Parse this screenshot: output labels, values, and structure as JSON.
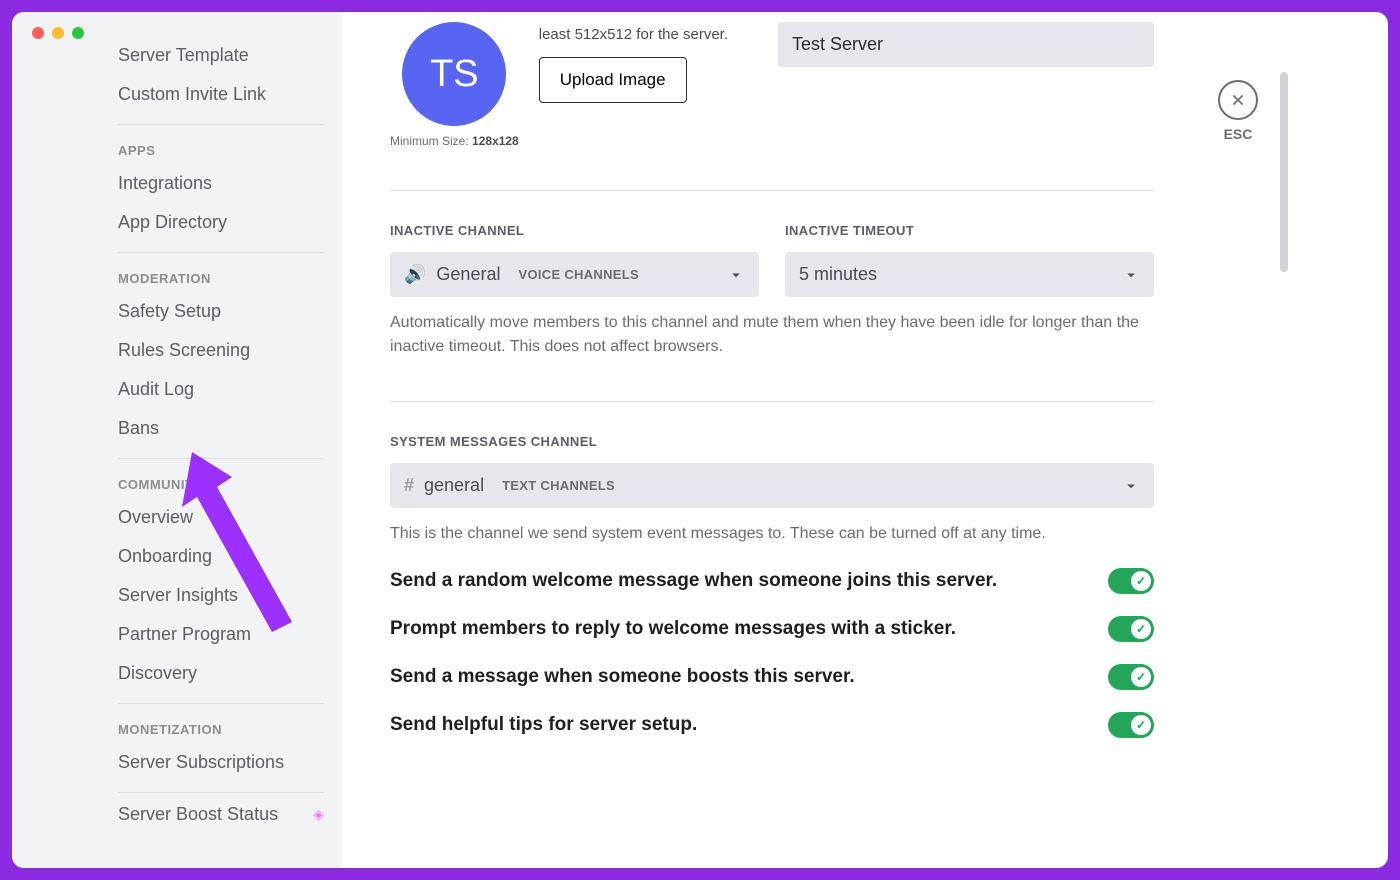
{
  "window": {
    "traffic": [
      "close",
      "min",
      "max"
    ]
  },
  "sidebar": {
    "top_items": [
      "Server Template",
      "Custom Invite Link"
    ],
    "groups": [
      {
        "header": "APPS",
        "items": [
          "Integrations",
          "App Directory"
        ]
      },
      {
        "header": "MODERATION",
        "items": [
          "Safety Setup",
          "Rules Screening",
          "Audit Log",
          "Bans"
        ]
      },
      {
        "header": "COMMUNITY",
        "items": [
          "Overview",
          "Onboarding",
          "Server Insights",
          "Partner Program",
          "Discovery"
        ]
      },
      {
        "header": "MONETIZATION",
        "items": [
          "Server Subscriptions"
        ]
      }
    ],
    "boost_item": "Server Boost Status"
  },
  "close": {
    "esc": "ESC"
  },
  "overview": {
    "avatar_initials": "TS",
    "min_size_prefix": "Minimum Size: ",
    "min_size_value": "128x128",
    "size_note": "least 512x512 for the server.",
    "upload_button": "Upload Image",
    "server_name": "Test Server",
    "inactive_channel_label": "INACTIVE CHANNEL",
    "inactive_channel_value": "General",
    "inactive_channel_sub": "VOICE CHANNELS",
    "inactive_timeout_label": "INACTIVE TIMEOUT",
    "inactive_timeout_value": "5 minutes",
    "inactive_help": "Automatically move members to this channel and mute them when they have been idle for longer than the inactive timeout. This does not affect browsers.",
    "system_label": "SYSTEM MESSAGES CHANNEL",
    "system_value": "general",
    "system_sub": "TEXT CHANNELS",
    "system_help": "This is the channel we send system event messages to. These can be turned off at any time.",
    "toggles": [
      "Send a random welcome message when someone joins this server.",
      "Prompt members to reply to welcome messages with a sticker.",
      "Send a message when someone boosts this server.",
      "Send helpful tips for server setup."
    ]
  }
}
